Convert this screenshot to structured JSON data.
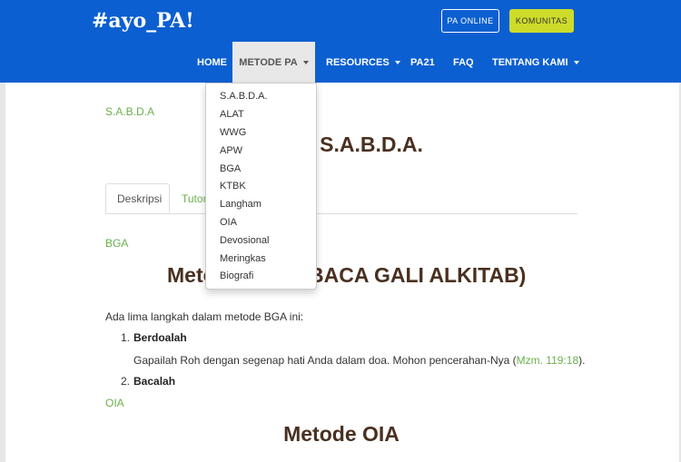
{
  "brand": "#ayo_PA!",
  "header_buttons": {
    "pa_online": "PA ONLINE",
    "komunitas": "KOMUNITAS"
  },
  "nav": {
    "home": "HOME",
    "metode_pa": "METODE PA",
    "resources": "RESOURCES",
    "pa21": "PA21",
    "faq": "FAQ",
    "tentang_kami": "TENTANG KAMI"
  },
  "dropdown": [
    "S.A.B.D.A.",
    "ALAT",
    "WWG",
    "APW",
    "BGA",
    "KTBK",
    "Langham",
    "OIA",
    "Devosional",
    "Meringkas",
    "Biografi"
  ],
  "page": {
    "breadcrumb": "S.A.B.D.A",
    "title_visible": "e S.A.B.D.A.",
    "tabs": [
      "Deskripsi",
      "Tutor"
    ],
    "bga_link": "BGA",
    "bga_heading_left": "Meto",
    "bga_heading_right": "BACA GALI ALKITAB)",
    "intro": "Ada lima langkah dalam metode BGA ini:",
    "steps": [
      {
        "number": "1.",
        "title": "Berdoalah",
        "desc": "Gapailah Roh dengan segenap hati Anda dalam doa. Mohon pencerahan-Nya (",
        "ref": "Mzm. 119:18",
        "desc_end": ")."
      },
      {
        "number": "2.",
        "title": "Bacalah"
      }
    ],
    "oia_link": "OIA",
    "oia_heading": "Metode OIA"
  },
  "colors": {
    "navbar": "#0c5fd0",
    "accent_yellow": "#cddc2a",
    "link_green": "#6ab04c",
    "heading_brown": "#4a3020"
  }
}
